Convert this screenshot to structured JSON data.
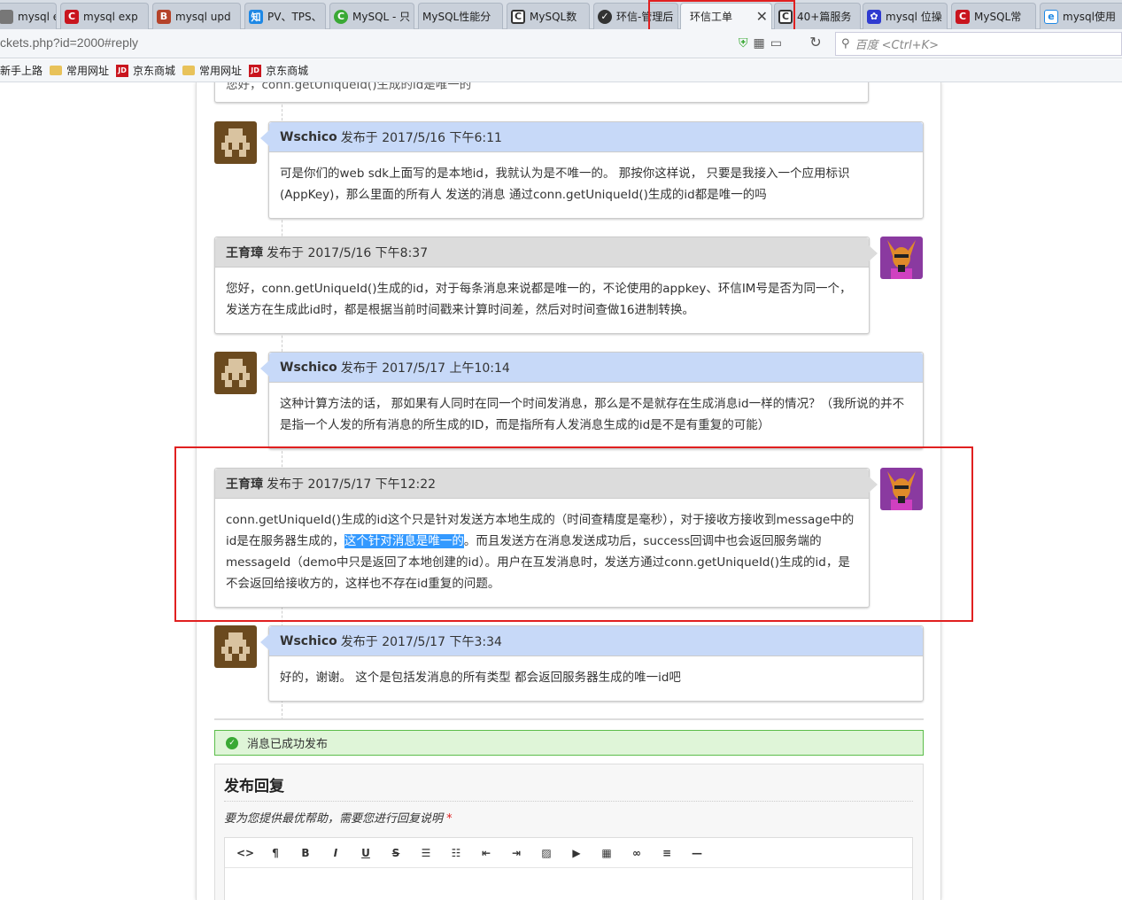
{
  "browser": {
    "tabs": [
      {
        "label": "mysql exp",
        "icon": "page-icon",
        "color": "#666666"
      },
      {
        "label": "mysql exp",
        "icon": "csdn-icon",
        "color": "#c9151e"
      },
      {
        "label": "mysql upd",
        "icon": "blog-icon",
        "color": "#b5432a"
      },
      {
        "label": "PV、TPS、",
        "icon": "zhihu-icon",
        "color": "#1e88e5"
      },
      {
        "label": "MySQL - 只",
        "icon": "green-icon",
        "color": "#3aa935"
      },
      {
        "label": "MySQL性能分",
        "icon": "page-icon",
        "color": "#888888"
      },
      {
        "label": "MySQL数",
        "icon": "cc-icon",
        "color": "#333333"
      },
      {
        "label": "环信-管理后",
        "icon": "gear-icon",
        "color": "#333333"
      },
      {
        "label": "环信工单",
        "icon": "none",
        "color": "#ffffff"
      },
      {
        "label": "40+篇服务",
        "icon": "cc-icon",
        "color": "#333333"
      },
      {
        "label": "mysql 位操",
        "icon": "paw-icon",
        "color": "#2f3bd0"
      },
      {
        "label": "MySQL常",
        "icon": "csdn-icon",
        "color": "#c9151e"
      },
      {
        "label": "mysql使用",
        "icon": "ie-icon",
        "color": "#1e88e5"
      }
    ],
    "active_tab": 8,
    "url": "ckets.php?id=2000#reply",
    "search_placeholder": "百度 <Ctrl+K>",
    "bookmarks": [
      {
        "label": "新手上路",
        "icon": "none"
      },
      {
        "label": "常用网址",
        "icon": "folder-icon"
      },
      {
        "label": "京东商城",
        "icon": "jd-icon"
      },
      {
        "label": "常用网址",
        "icon": "folder-icon"
      },
      {
        "label": "京东商城",
        "icon": "jd-icon"
      }
    ]
  },
  "thread": {
    "top_fragment": "您好，conn.getUniqueId()生成的id是唯一的",
    "messages": [
      {
        "role": "user",
        "author": "Wschico",
        "meta": "发布于 2017/5/16 下午6:11",
        "body": "可是你们的web sdk上面写的是本地id，我就认为是不唯一的。 那按你这样说， 只要是我接入一个应用标识(AppKey)，那么里面的所有人 发送的消息 通过conn.getUniqueId()生成的id都是唯一的吗"
      },
      {
        "role": "staff",
        "author": "王育璋",
        "meta": "发布于 2017/5/16 下午8:37",
        "body": "您好，conn.getUniqueId()生成的id，对于每条消息来说都是唯一的，不论使用的appkey、环信IM号是否为同一个，发送方在生成此id时，都是根据当前时间戳来计算时间差，然后对时间查做16进制转换。"
      },
      {
        "role": "user",
        "author": "Wschico",
        "meta": "发布于 2017/5/17 上午10:14",
        "body": "这种计算方法的话， 那如果有人同时在同一个时间发消息，那么是不是就存在生成消息id一样的情况？（我所说的并不是指一个人发的所有消息的所生成的ID，而是指所有人发消息生成的id是不是有重复的可能）"
      },
      {
        "role": "staff",
        "author": "王育璋",
        "meta": "发布于 2017/5/17 下午12:22",
        "body_before": "conn.getUniqueId()生成的id这个只是针对发送方本地生成的（时间查精度是毫秒），对于接收方接收到message中的id是在服务器生成的，",
        "body_highlight": "这个针对消息是唯一的",
        "body_after": "。而且发送方在消息发送成功后，success回调中也会返回服务端的messageId（demo中只是返回了本地创建的id）。用户在互发消息时，发送方通过conn.getUniqueId()生成的id，是不会返回给接收方的，这样也不存在id重复的问题。"
      },
      {
        "role": "user",
        "author": "Wschico",
        "meta": "发布于 2017/5/17 下午3:34",
        "body": "好的，谢谢。 这个是包括发消息的所有类型 都会返回服务器生成的唯一id吧"
      }
    ]
  },
  "status": {
    "text": "消息已成功发布",
    "color": "#3aa935"
  },
  "reply": {
    "title": "发布回复",
    "description": "要为您提供最优帮助，需要您进行回复说明",
    "required_mark": "*",
    "toolbar": [
      {
        "name": "code-icon",
        "glyph": "<>"
      },
      {
        "name": "paragraph-icon",
        "glyph": "¶"
      },
      {
        "name": "bold-icon",
        "glyph": "B"
      },
      {
        "name": "italic-icon",
        "glyph": "I"
      },
      {
        "name": "underline-icon",
        "glyph": "U"
      },
      {
        "name": "strikethrough-icon",
        "glyph": "S"
      },
      {
        "name": "bullet-list-icon",
        "glyph": "☰"
      },
      {
        "name": "numbered-list-icon",
        "glyph": "☷"
      },
      {
        "name": "outdent-icon",
        "glyph": "⇤"
      },
      {
        "name": "indent-icon",
        "glyph": "⇥"
      },
      {
        "name": "image-icon",
        "glyph": "▨"
      },
      {
        "name": "video-icon",
        "glyph": "▶"
      },
      {
        "name": "table-icon",
        "glyph": "▦"
      },
      {
        "name": "link-icon",
        "glyph": "∞"
      },
      {
        "name": "align-icon",
        "glyph": "≡"
      },
      {
        "name": "horizontal-rule-icon",
        "glyph": "—"
      }
    ]
  },
  "colors": {
    "user_header": "#c7d9f8",
    "staff_header": "#dcdcdc",
    "annotation_box": "#e02020",
    "selection": "#3399ff"
  }
}
